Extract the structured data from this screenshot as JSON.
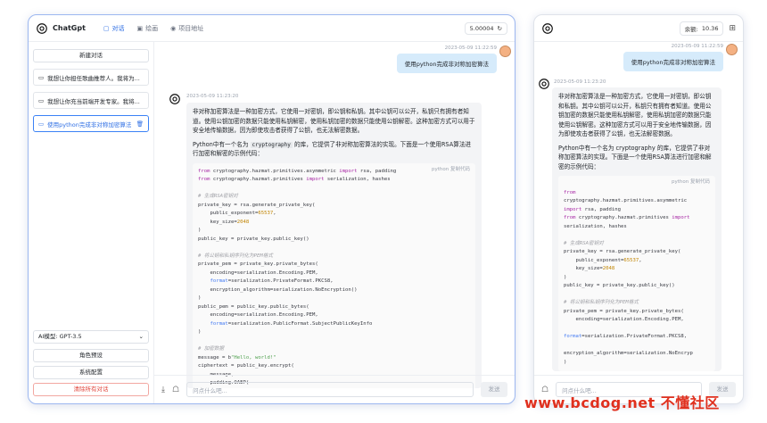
{
  "app": {
    "name": "ChatGpt"
  },
  "tabs": [
    {
      "label": "对话"
    },
    {
      "label": "绘画"
    },
    {
      "label": "项目地址"
    }
  ],
  "balance": "5.00004",
  "sidebar": {
    "new_chat": "新建对话",
    "conversations": [
      {
        "label": "我想让你担任歌曲推荐人。我将为..."
      },
      {
        "label": "我想让你充当前端开发专家。我将..."
      },
      {
        "label": "使用python完成非对称加密算法"
      }
    ],
    "model_select": "AI模型: GPT-3.5",
    "role_button": "角色预设",
    "settings_button": "系统配置",
    "clear_button": "清除所有对话"
  },
  "chat": {
    "user_time": "2023-05-09 11:22:59",
    "user_text": "使用python完成非对称加密算法",
    "ai_time": "2023-05-09 11:23:20",
    "ai_para1": "非对称加密算法是一种加密方式，它使用一对密钥，即公钥和私钥。其中公钥可以公开，私钥只有拥有者知道。使用公钥加密的数据只能使用私钥解密，使用私钥加密的数据只能使用公钥解密。这种加密方式可以用于安全地传输数据，因为即使攻击者获得了公钥，也无法解密数据。",
    "ai_para2_pre": "Python中有一个名为",
    "ai_para2_lib": "cryptography",
    "ai_para2_post": "的库，它提供了非对称加密算法的实现。下面是一个使用RSA算法进行加密和解密的示例代码：",
    "code_lang": "python",
    "code_copy": "复制代码"
  },
  "input": {
    "placeholder": "问点什么吧...",
    "send": "发送"
  },
  "mobile": {
    "balance_label": "余额: ",
    "balance_value": "10.36",
    "user_time": "2023-05-09 11:22:59",
    "user_text": "使用python完成非对称加密算法",
    "ai_time": "2023-05-09 11:23:20",
    "ai_para1": "非对称加密算法是一种加密方式，它使用一对密钥，即公钥和私钥。其中公钥可以公开，私钥只有拥有者知道。使用公钥加密的数据只能使用私钥解密，使用私钥加密的数据只能使用公钥解密。这种加密方式可以用于安全地传输数据，因为即使攻击者获得了公钥，也无法解密数据。",
    "ai_para2": "Python中有一个名为 cryptography 的库，它提供了非对称加密算法的实现。下面是一个使用RSA算法进行加密和解密的示例代码：",
    "code_header": "python 复制代码",
    "placeholder": "问点什么吧...",
    "send": "发送"
  },
  "watermark": "www.bcdog.net 不懂社区",
  "colors": {
    "accent": "#2f6fe4",
    "user_bubble": "#d6ebfb",
    "danger": "#e0453b"
  }
}
